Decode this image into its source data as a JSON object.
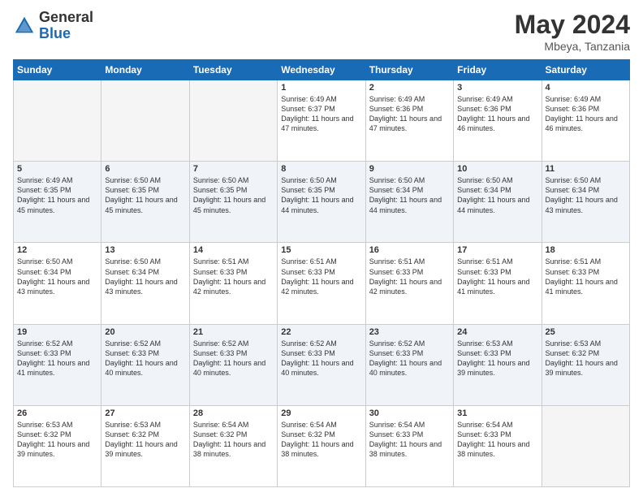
{
  "header": {
    "logo_general": "General",
    "logo_blue": "Blue",
    "title": "May 2024",
    "location": "Mbeya, Tanzania"
  },
  "weekdays": [
    "Sunday",
    "Monday",
    "Tuesday",
    "Wednesday",
    "Thursday",
    "Friday",
    "Saturday"
  ],
  "weeks": [
    [
      {
        "day": "",
        "info": ""
      },
      {
        "day": "",
        "info": ""
      },
      {
        "day": "",
        "info": ""
      },
      {
        "day": "1",
        "info": "Sunrise: 6:49 AM\nSunset: 6:37 PM\nDaylight: 11 hours\nand 47 minutes."
      },
      {
        "day": "2",
        "info": "Sunrise: 6:49 AM\nSunset: 6:36 PM\nDaylight: 11 hours\nand 47 minutes."
      },
      {
        "day": "3",
        "info": "Sunrise: 6:49 AM\nSunset: 6:36 PM\nDaylight: 11 hours\nand 46 minutes."
      },
      {
        "day": "4",
        "info": "Sunrise: 6:49 AM\nSunset: 6:36 PM\nDaylight: 11 hours\nand 46 minutes."
      }
    ],
    [
      {
        "day": "5",
        "info": "Sunrise: 6:49 AM\nSunset: 6:35 PM\nDaylight: 11 hours\nand 45 minutes."
      },
      {
        "day": "6",
        "info": "Sunrise: 6:50 AM\nSunset: 6:35 PM\nDaylight: 11 hours\nand 45 minutes."
      },
      {
        "day": "7",
        "info": "Sunrise: 6:50 AM\nSunset: 6:35 PM\nDaylight: 11 hours\nand 45 minutes."
      },
      {
        "day": "8",
        "info": "Sunrise: 6:50 AM\nSunset: 6:35 PM\nDaylight: 11 hours\nand 44 minutes."
      },
      {
        "day": "9",
        "info": "Sunrise: 6:50 AM\nSunset: 6:34 PM\nDaylight: 11 hours\nand 44 minutes."
      },
      {
        "day": "10",
        "info": "Sunrise: 6:50 AM\nSunset: 6:34 PM\nDaylight: 11 hours\nand 44 minutes."
      },
      {
        "day": "11",
        "info": "Sunrise: 6:50 AM\nSunset: 6:34 PM\nDaylight: 11 hours\nand 43 minutes."
      }
    ],
    [
      {
        "day": "12",
        "info": "Sunrise: 6:50 AM\nSunset: 6:34 PM\nDaylight: 11 hours\nand 43 minutes."
      },
      {
        "day": "13",
        "info": "Sunrise: 6:50 AM\nSunset: 6:34 PM\nDaylight: 11 hours\nand 43 minutes."
      },
      {
        "day": "14",
        "info": "Sunrise: 6:51 AM\nSunset: 6:33 PM\nDaylight: 11 hours\nand 42 minutes."
      },
      {
        "day": "15",
        "info": "Sunrise: 6:51 AM\nSunset: 6:33 PM\nDaylight: 11 hours\nand 42 minutes."
      },
      {
        "day": "16",
        "info": "Sunrise: 6:51 AM\nSunset: 6:33 PM\nDaylight: 11 hours\nand 42 minutes."
      },
      {
        "day": "17",
        "info": "Sunrise: 6:51 AM\nSunset: 6:33 PM\nDaylight: 11 hours\nand 41 minutes."
      },
      {
        "day": "18",
        "info": "Sunrise: 6:51 AM\nSunset: 6:33 PM\nDaylight: 11 hours\nand 41 minutes."
      }
    ],
    [
      {
        "day": "19",
        "info": "Sunrise: 6:52 AM\nSunset: 6:33 PM\nDaylight: 11 hours\nand 41 minutes."
      },
      {
        "day": "20",
        "info": "Sunrise: 6:52 AM\nSunset: 6:33 PM\nDaylight: 11 hours\nand 40 minutes."
      },
      {
        "day": "21",
        "info": "Sunrise: 6:52 AM\nSunset: 6:33 PM\nDaylight: 11 hours\nand 40 minutes."
      },
      {
        "day": "22",
        "info": "Sunrise: 6:52 AM\nSunset: 6:33 PM\nDaylight: 11 hours\nand 40 minutes."
      },
      {
        "day": "23",
        "info": "Sunrise: 6:52 AM\nSunset: 6:33 PM\nDaylight: 11 hours\nand 40 minutes."
      },
      {
        "day": "24",
        "info": "Sunrise: 6:53 AM\nSunset: 6:33 PM\nDaylight: 11 hours\nand 39 minutes."
      },
      {
        "day": "25",
        "info": "Sunrise: 6:53 AM\nSunset: 6:32 PM\nDaylight: 11 hours\nand 39 minutes."
      }
    ],
    [
      {
        "day": "26",
        "info": "Sunrise: 6:53 AM\nSunset: 6:32 PM\nDaylight: 11 hours\nand 39 minutes."
      },
      {
        "day": "27",
        "info": "Sunrise: 6:53 AM\nSunset: 6:32 PM\nDaylight: 11 hours\nand 39 minutes."
      },
      {
        "day": "28",
        "info": "Sunrise: 6:54 AM\nSunset: 6:32 PM\nDaylight: 11 hours\nand 38 minutes."
      },
      {
        "day": "29",
        "info": "Sunrise: 6:54 AM\nSunset: 6:32 PM\nDaylight: 11 hours\nand 38 minutes."
      },
      {
        "day": "30",
        "info": "Sunrise: 6:54 AM\nSunset: 6:33 PM\nDaylight: 11 hours\nand 38 minutes."
      },
      {
        "day": "31",
        "info": "Sunrise: 6:54 AM\nSunset: 6:33 PM\nDaylight: 11 hours\nand 38 minutes."
      },
      {
        "day": "",
        "info": ""
      }
    ]
  ]
}
